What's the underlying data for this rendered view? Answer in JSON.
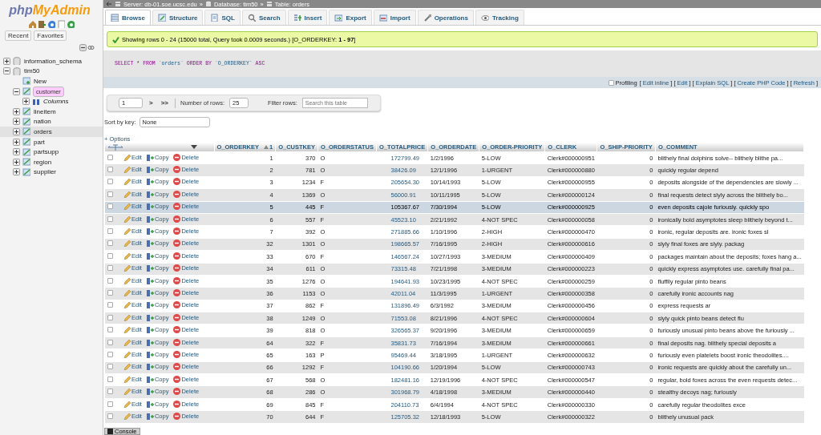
{
  "sidebar": {
    "logo": {
      "part1": "php",
      "part2": "MyAdmin"
    },
    "tabs": [
      {
        "label": "Recent",
        "selected": false
      },
      {
        "label": "Favorites",
        "selected": false
      }
    ],
    "tree": [
      {
        "label": "information_schema",
        "kind": "db",
        "expanded": false,
        "selected": false
      },
      {
        "label": "tim50",
        "kind": "db",
        "expanded": true,
        "selected": false,
        "children": [
          {
            "label": "New",
            "kind": "new",
            "selected": false
          },
          {
            "label": "customer",
            "kind": "table",
            "expanded": true,
            "selected": true,
            "children": [
              {
                "label": "Columns",
                "kind": "columns",
                "expanded": false,
                "selected": false
              }
            ]
          },
          {
            "label": "lineitem",
            "kind": "table",
            "expanded": false,
            "selected": false
          },
          {
            "label": "nation",
            "kind": "table",
            "expanded": false,
            "selected": false
          },
          {
            "label": "orders",
            "kind": "table",
            "expanded": false,
            "selected": false,
            "current": true
          },
          {
            "label": "part",
            "kind": "table",
            "expanded": false,
            "selected": false
          },
          {
            "label": "partsupp",
            "kind": "table",
            "expanded": false,
            "selected": false
          },
          {
            "label": "region",
            "kind": "table",
            "expanded": false,
            "selected": false
          },
          {
            "label": "supplier",
            "kind": "table",
            "expanded": false,
            "selected": false
          }
        ]
      }
    ]
  },
  "breadcrumb": {
    "separator": "»",
    "items": [
      {
        "kind": "server",
        "label": "Server: db-01.soe.ucsc.edu"
      },
      {
        "kind": "database",
        "label": "Database: tim50"
      },
      {
        "kind": "table",
        "label": "Table: orders"
      }
    ]
  },
  "tabs": [
    {
      "label": "Browse",
      "kind": "browse",
      "selected": true
    },
    {
      "label": "Structure",
      "kind": "structure",
      "selected": false
    },
    {
      "label": "SQL",
      "kind": "sql",
      "selected": false
    },
    {
      "label": "Search",
      "kind": "search",
      "selected": false
    },
    {
      "label": "Insert",
      "kind": "insert",
      "selected": false
    },
    {
      "label": "Export",
      "kind": "export",
      "selected": false
    },
    {
      "label": "Import",
      "kind": "import",
      "selected": false
    },
    {
      "label": "Operations",
      "kind": "operations",
      "selected": false
    },
    {
      "label": "Tracking",
      "kind": "tracking",
      "selected": false
    }
  ],
  "message": "Showing rows 0 - 24 (15000 total, Query took 0.0009 seconds.) [O_ORDERKEY: **1 - 97**]",
  "sql": [
    {
      "kind": "keyword",
      "text": "SELECT"
    },
    {
      "kind": "plain",
      "text": "*"
    },
    {
      "kind": "keyword",
      "text": "FROM"
    },
    {
      "kind": "name",
      "text": "`orders`"
    },
    {
      "kind": "keyword",
      "text": "ORDER BY"
    },
    {
      "kind": "name",
      "text": "`O_ORDERKEY`"
    },
    {
      "kind": "keyword",
      "text": "ASC"
    }
  ],
  "profiling": {
    "label": "Profiling",
    "checked": false,
    "open": "[",
    "close": "]",
    "links": [
      "Edit inline",
      "Edit",
      "Explain SQL",
      "Create PHP Code",
      "Refresh"
    ]
  },
  "navigation": {
    "page": "1",
    "next": ">",
    "last": ">>",
    "rows_label": "Number of rows:",
    "rows": "25",
    "filter_label": "Filter rows:",
    "filter_placeholder": "Search this table"
  },
  "sort": {
    "label": "Sort by key:",
    "value": "None"
  },
  "options": "+ Options",
  "table": {
    "sort_order": "1",
    "columns": [
      {
        "label": "O_ORDERKEY",
        "kind": "number",
        "sorted": true
      },
      {
        "label": "O_CUSTKEY",
        "kind": "number",
        "sorted": false
      },
      {
        "label": "O_ORDERSTATUS",
        "kind": "text",
        "sorted": false
      },
      {
        "label": "O_TOTALPRICE",
        "kind": "link",
        "sorted": false
      },
      {
        "label": "O_ORDERDATE",
        "kind": "text",
        "sorted": false
      },
      {
        "label": "O_ORDER-PRIORITY",
        "kind": "text",
        "sorted": false
      },
      {
        "label": "O_CLERK",
        "kind": "text",
        "sorted": false
      },
      {
        "label": "O_SHIP-PRIORITY",
        "kind": "number",
        "sorted": false
      },
      {
        "label": "O_COMMENT",
        "kind": "text",
        "sorted": false
      }
    ],
    "rows": [
      {
        "highlighted": false,
        "checked": false,
        "actions": [
          "Edit",
          "Copy",
          "Delete"
        ],
        "cells": [
          "1",
          "370",
          "O",
          "172799.49",
          "1/2/1996",
          "5-LOW",
          "Clerk#000000951",
          "0",
          "blithely final dolphins solve-- blithely blithe pa..."
        ]
      },
      {
        "highlighted": false,
        "checked": false,
        "actions": [
          "Edit",
          "Copy",
          "Delete"
        ],
        "cells": [
          "2",
          "781",
          "O",
          "38426.09",
          "12/1/1996",
          "1-URGENT",
          "Clerk#000000880",
          "0",
          "quickly regular depend"
        ]
      },
      {
        "highlighted": false,
        "checked": false,
        "actions": [
          "Edit",
          "Copy",
          "Delete"
        ],
        "cells": [
          "3",
          "1234",
          "F",
          "205654.30",
          "10/14/1993",
          "5-LOW",
          "Clerk#000000955",
          "0",
          "deposits alongside of the dependencies are slowly ..."
        ]
      },
      {
        "highlighted": false,
        "checked": false,
        "actions": [
          "Edit",
          "Copy",
          "Delete"
        ],
        "cells": [
          "4",
          "1369",
          "O",
          "56000.91",
          "10/11/1995",
          "5-LOW",
          "Clerk#000000124",
          "0",
          "final requests detect slyly across the blithely bo..."
        ]
      },
      {
        "highlighted": true,
        "checked": false,
        "actions": [
          "Edit",
          "Copy",
          "Delete"
        ],
        "cells": [
          "5",
          "445",
          "F",
          "105367.67",
          "7/30/1994",
          "5-LOW",
          "Clerk#000000925",
          "0",
          "even deposits cajole furiously. quickly spo"
        ]
      },
      {
        "highlighted": false,
        "checked": false,
        "actions": [
          "Edit",
          "Copy",
          "Delete"
        ],
        "cells": [
          "6",
          "557",
          "F",
          "45523.10",
          "2/21/1992",
          "4-NOT SPEC",
          "Clerk#000000058",
          "0",
          "ironically bold asymptotes sleep blithely beyond t..."
        ]
      },
      {
        "highlighted": false,
        "checked": false,
        "actions": [
          "Edit",
          "Copy",
          "Delete"
        ],
        "cells": [
          "7",
          "392",
          "O",
          "271885.66",
          "1/10/1996",
          "2-HIGH",
          "Clerk#000000470",
          "0",
          "ironic, regular deposits are. ironic foxes sl"
        ]
      },
      {
        "highlighted": false,
        "checked": false,
        "actions": [
          "Edit",
          "Copy",
          "Delete"
        ],
        "cells": [
          "32",
          "1301",
          "O",
          "198665.57",
          "7/16/1995",
          "2-HIGH",
          "Clerk#000000616",
          "0",
          "slyly final foxes are slyly. packag"
        ]
      },
      {
        "highlighted": false,
        "checked": false,
        "actions": [
          "Edit",
          "Copy",
          "Delete"
        ],
        "cells": [
          "33",
          "670",
          "F",
          "146567.24",
          "10/27/1993",
          "3-MEDIUM",
          "Clerk#000000409",
          "0",
          "packages maintain about the deposits; foxes hang a..."
        ]
      },
      {
        "highlighted": false,
        "checked": false,
        "actions": [
          "Edit",
          "Copy",
          "Delete"
        ],
        "cells": [
          "34",
          "611",
          "O",
          "73315.48",
          "7/21/1998",
          "3-MEDIUM",
          "Clerk#000000223",
          "0",
          "quickly express asymptotes use. carefully final pa..."
        ]
      },
      {
        "highlighted": false,
        "checked": false,
        "actions": [
          "Edit",
          "Copy",
          "Delete"
        ],
        "cells": [
          "35",
          "1276",
          "O",
          "194641.93",
          "10/23/1995",
          "4-NOT SPEC",
          "Clerk#000000259",
          "0",
          "fluffily regular pinto beans"
        ]
      },
      {
        "highlighted": false,
        "checked": false,
        "actions": [
          "Edit",
          "Copy",
          "Delete"
        ],
        "cells": [
          "36",
          "1153",
          "O",
          "42011.04",
          "11/3/1995",
          "1-URGENT",
          "Clerk#000000358",
          "0",
          "carefully ironic accounts nag"
        ]
      },
      {
        "highlighted": false,
        "checked": false,
        "actions": [
          "Edit",
          "Copy",
          "Delete"
        ],
        "cells": [
          "37",
          "862",
          "F",
          "131896.49",
          "6/3/1992",
          "3-MEDIUM",
          "Clerk#000000456",
          "0",
          "express requests ar"
        ]
      },
      {
        "highlighted": false,
        "checked": false,
        "actions": [
          "Edit",
          "Copy",
          "Delete"
        ],
        "cells": [
          "38",
          "1249",
          "O",
          "71553.08",
          "8/21/1996",
          "4-NOT SPEC",
          "Clerk#000000604",
          "0",
          "slyly quick pinto beans detect flu"
        ]
      },
      {
        "highlighted": false,
        "checked": false,
        "actions": [
          "Edit",
          "Copy",
          "Delete"
        ],
        "cells": [
          "39",
          "818",
          "O",
          "326565.37",
          "9/20/1996",
          "3-MEDIUM",
          "Clerk#000000659",
          "0",
          "furiously unusual pinto beans above the furiously ..."
        ]
      },
      {
        "highlighted": false,
        "checked": false,
        "actions": [
          "Edit",
          "Copy",
          "Delete"
        ],
        "cells": [
          "64",
          "322",
          "F",
          "35831.73",
          "7/16/1994",
          "3-MEDIUM",
          "Clerk#000000661",
          "0",
          "final deposits nag. blithely special deposits a"
        ]
      },
      {
        "highlighted": false,
        "checked": false,
        "actions": [
          "Edit",
          "Copy",
          "Delete"
        ],
        "cells": [
          "65",
          "163",
          "P",
          "95469.44",
          "3/18/1995",
          "1-URGENT",
          "Clerk#000000632",
          "0",
          "furiously even platelets boost ironic theodolites...."
        ]
      },
      {
        "highlighted": false,
        "checked": false,
        "actions": [
          "Edit",
          "Copy",
          "Delete"
        ],
        "cells": [
          "66",
          "1292",
          "F",
          "104190.66",
          "1/20/1994",
          "5-LOW",
          "Clerk#000000743",
          "0",
          "ironic requests are quickly about the carefully un..."
        ]
      },
      {
        "highlighted": false,
        "checked": false,
        "actions": [
          "Edit",
          "Copy",
          "Delete"
        ],
        "cells": [
          "67",
          "568",
          "O",
          "182481.16",
          "12/19/1996",
          "4-NOT SPEC",
          "Clerk#000000547",
          "0",
          "regular, bold foxes across the even requests detec..."
        ]
      },
      {
        "highlighted": false,
        "checked": false,
        "actions": [
          "Edit",
          "Copy",
          "Delete"
        ],
        "cells": [
          "68",
          "286",
          "O",
          "301968.79",
          "4/18/1998",
          "3-MEDIUM",
          "Clerk#000000440",
          "0",
          "stealthy decoys nag; furiously"
        ]
      },
      {
        "highlighted": false,
        "checked": false,
        "actions": [
          "Edit",
          "Copy",
          "Delete"
        ],
        "cells": [
          "69",
          "845",
          "F",
          "204110.73",
          "6/4/1994",
          "4-NOT SPEC",
          "Clerk#000000330",
          "0",
          "carefully regular theodolites exce"
        ]
      },
      {
        "highlighted": false,
        "checked": false,
        "actions": [
          "Edit",
          "Copy",
          "Delete"
        ],
        "cells": [
          "70",
          "644",
          "F",
          "125705.32",
          "12/18/1993",
          "5-LOW",
          "Clerk#000000322",
          "0",
          "blithely unusual pack"
        ]
      }
    ]
  },
  "console": "Console"
}
